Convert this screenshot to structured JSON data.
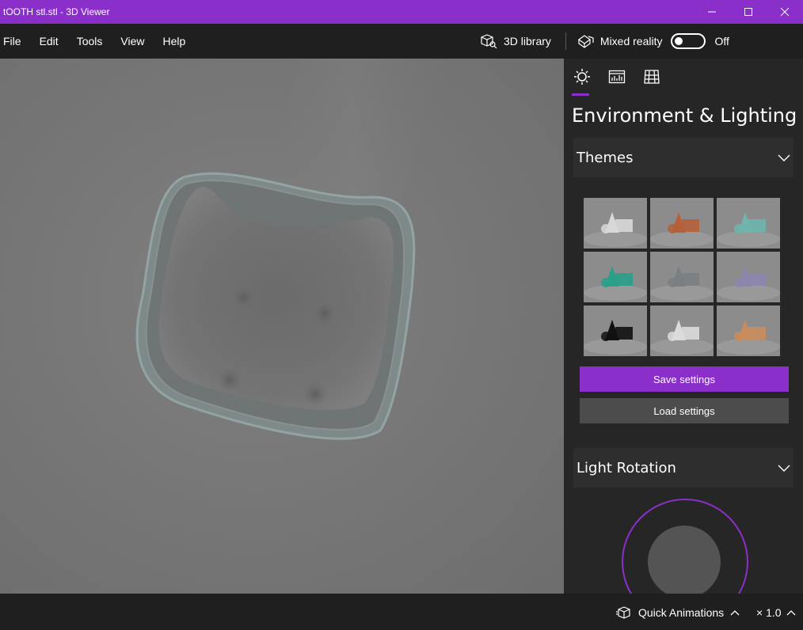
{
  "window": {
    "title": "tOOTH stl.stl - 3D Viewer",
    "accent_color": "#8a2fc9"
  },
  "menu": {
    "items": [
      "File",
      "Edit",
      "Tools",
      "View",
      "Help"
    ],
    "library_label": "3D library",
    "mixed_reality_label": "Mixed reality",
    "mixed_reality_state": "Off"
  },
  "panel": {
    "tabs": [
      "sun-settings-icon",
      "stats-icon",
      "grid-icon"
    ],
    "title": "Environment & Lighting",
    "themes": {
      "label": "Themes",
      "selected_index": 7,
      "swatch_colors": [
        "#d8d8d8",
        "#b5603a",
        "#6fb5ad",
        "#28a08a",
        "#7a7f82",
        "#8c86ae",
        "#111111",
        "#dcdcdc",
        "#c98c5c"
      ]
    },
    "save_label": "Save settings",
    "load_label": "Load settings",
    "light_rotation_label": "Light Rotation"
  },
  "status": {
    "quick_animations_label": "Quick Animations",
    "speed_label": "× 1.0"
  }
}
